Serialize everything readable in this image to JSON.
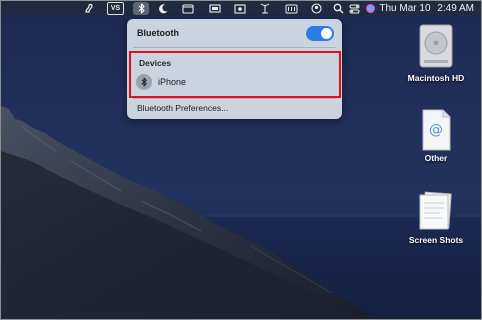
{
  "menubar": {
    "items": [
      {
        "icon": "script-editor-icon"
      },
      {
        "icon": "vs-icon",
        "text": "VS"
      },
      {
        "icon": "bluetooth-icon",
        "active": true
      },
      {
        "icon": "night-shift-moon-icon"
      },
      {
        "icon": "window-icon"
      },
      {
        "icon": "display-icon"
      },
      {
        "icon": "screen-record-icon"
      },
      {
        "icon": "antenna-icon"
      },
      {
        "icon": "wifi-icon"
      },
      {
        "icon": "user-circle-icon"
      },
      {
        "icon": "battery-icon"
      },
      {
        "icon": "search-icon"
      },
      {
        "icon": "control-center-icon"
      },
      {
        "icon": "siri-icon"
      }
    ],
    "clock": {
      "date": "Thu Mar 10",
      "time": "2:49 AM"
    }
  },
  "bluetooth_menu": {
    "title": "Bluetooth",
    "toggle_on": true,
    "devices_heading": "Devices",
    "devices": [
      {
        "name": "iPhone",
        "icon": "bluetooth-icon"
      }
    ],
    "preferences_label": "Bluetooth Preferences...",
    "highlight_color": "#e0101a",
    "accent": "#2b7de3"
  },
  "desktop": {
    "icons": [
      {
        "label": "Macintosh HD",
        "icon": "hard-drive-icon"
      },
      {
        "label": "Other",
        "icon": "document-at-icon"
      },
      {
        "label": "Screen Shots",
        "icon": "folder-stack-icon"
      }
    ]
  }
}
